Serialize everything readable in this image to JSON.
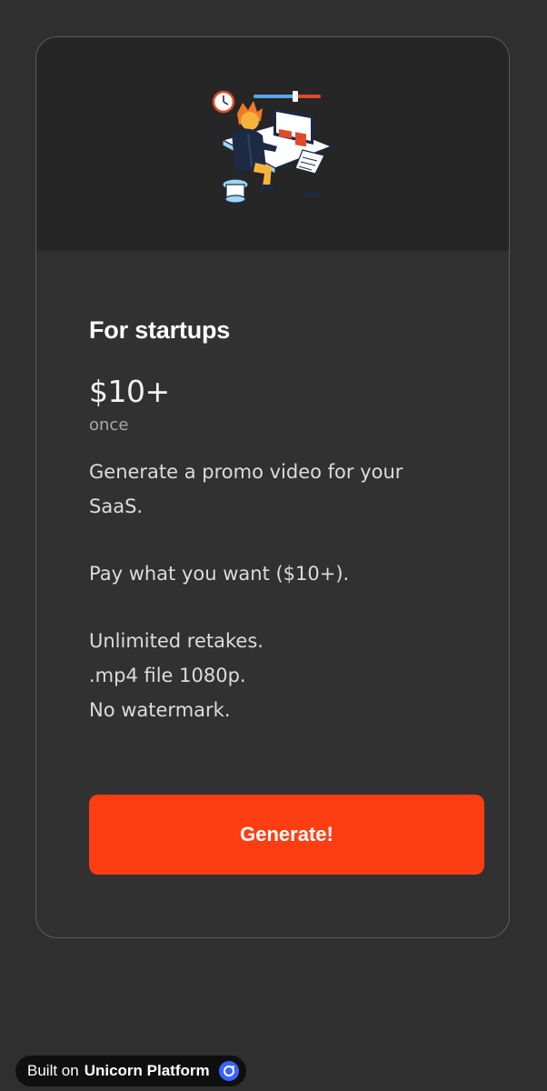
{
  "card": {
    "illustration_icon": "developer-at-desk-illustration",
    "title": "For startups",
    "price": "$10+",
    "period": "once",
    "description": [
      "Generate a promo video for your SaaS.",
      "Pay what you want ($10+).",
      "Unlimited retakes.\n.mp4 file 1080p.\nNo watermark."
    ],
    "cta_label": "Generate!"
  },
  "footer_badge": {
    "prefix": "Built on",
    "brand": "Unicorn Platform",
    "logo_icon": "unicorn-platform-logo-icon"
  },
  "colors": {
    "background": "#2f2f2f",
    "card_hero": "#262626",
    "accent": "#ff3d12",
    "badge_logo": "#3a63ff"
  }
}
